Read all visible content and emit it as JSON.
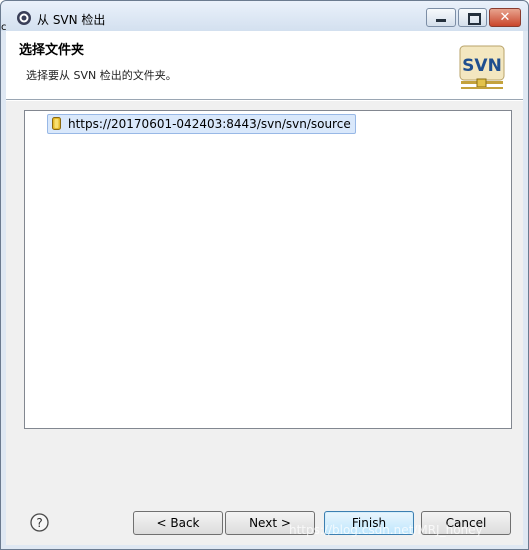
{
  "window": {
    "title": "从 SVN 检出",
    "stray_char": "c",
    "minimize_glyph": "",
    "close_glyph": "✕"
  },
  "header": {
    "title": "选择文件夹",
    "description": "选择要从 SVN 检出的文件夹。",
    "logo_text": "SVN"
  },
  "tree": {
    "items": [
      {
        "label": "https://20170601-042403:8443/svn/svn/source",
        "selected": true,
        "icon": "repository-icon"
      }
    ]
  },
  "buttons": {
    "help": "?",
    "back": "< Back",
    "next": "Next >",
    "finish": "Finish",
    "cancel": "Cancel"
  },
  "watermark": "https://blog.csdn.net/MRJ_honey",
  "colors": {
    "selection": "#d9e8fb",
    "default_button_border": "#3c7fb1",
    "close_button": "#c9462c"
  }
}
